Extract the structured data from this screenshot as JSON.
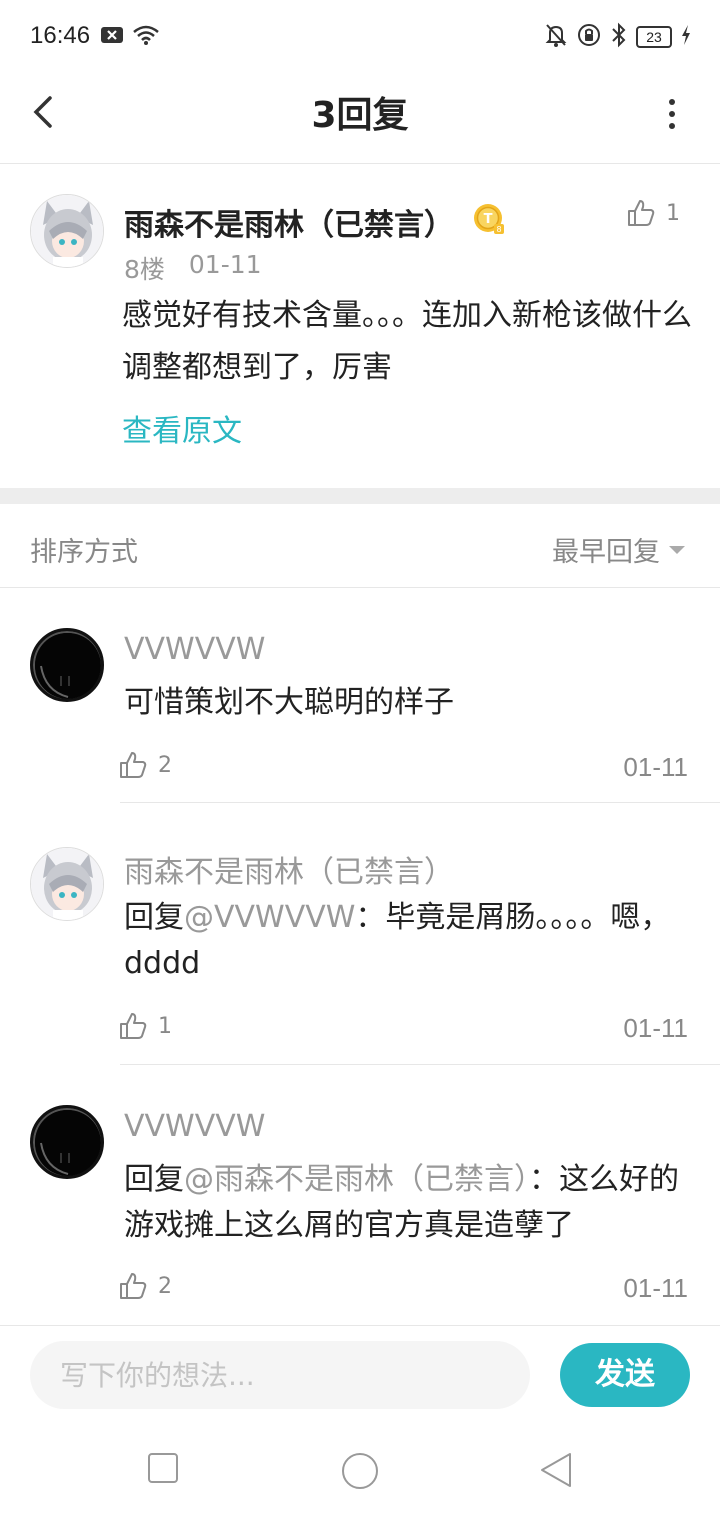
{
  "status_bar": {
    "time": "16:46",
    "battery": "23",
    "icons": [
      "notification-x-icon",
      "wifi-icon",
      "mute-bell-icon",
      "rotation-lock-icon",
      "bluetooth-icon",
      "battery-icon",
      "charging-icon"
    ]
  },
  "nav": {
    "title": "3回复",
    "back_icon": "chevron-left-icon",
    "more_icon": "more-vertical-icon"
  },
  "op_post": {
    "username": "雨森不是雨林（已禁言）",
    "floor": "8楼",
    "date": "01-11",
    "likes": "1",
    "content": "感觉好有技术含量。。。连加入新枪该做什么调整都想到了，厉害",
    "view_original": "查看原文"
  },
  "sort": {
    "label": "排序方式",
    "selected": "最早回复"
  },
  "replies": [
    {
      "username": "VVWVVW",
      "mention": "",
      "content": "可惜策划不大聪明的样子",
      "likes": "2",
      "date": "01-11"
    },
    {
      "username": "雨森不是雨林（已禁言）",
      "prefix": "回复",
      "mention": "@VVWVVW",
      "content": "：毕竟是屑肠。。。。嗯，dddd",
      "likes": "1",
      "date": "01-11"
    },
    {
      "username": "VVWVVW",
      "prefix": "回复",
      "mention": "@雨森不是雨林（已禁言）",
      "content": "：这么好的游戏摊上这么屑的官方真是造孽了",
      "likes": "2",
      "date": "01-11"
    }
  ],
  "input": {
    "placeholder": "写下你的想法...",
    "send_label": "发送"
  },
  "colors": {
    "accent": "#2ab7c2",
    "muted_text": "#999999",
    "divider": "#e7e7e7"
  }
}
